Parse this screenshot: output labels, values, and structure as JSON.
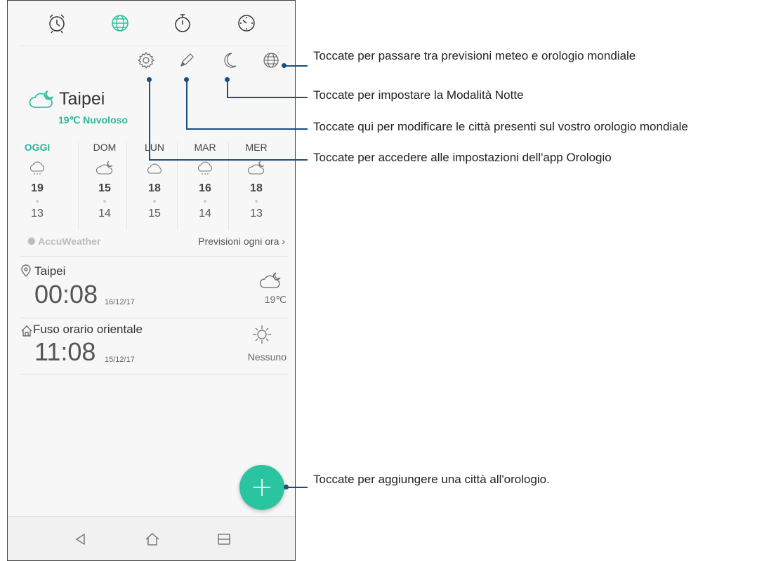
{
  "tabs": [
    {
      "icon": "alarm-clock-icon"
    },
    {
      "icon": "globe-icon",
      "active": true
    },
    {
      "icon": "stopwatch-icon"
    },
    {
      "icon": "timer-icon"
    }
  ],
  "toolbar": [
    "gear-icon",
    "pencil-icon",
    "moon-icon",
    "globe-icon"
  ],
  "weather": {
    "city": "Taipei",
    "current": "19℃  Nuvoloso",
    "days": [
      {
        "name": "OGGI",
        "hi": "19",
        "lo": "13",
        "icon": "rain-cloud-icon",
        "today": true
      },
      {
        "name": "DOM",
        "hi": "15",
        "lo": "14",
        "icon": "partly-cloudy-night-icon"
      },
      {
        "name": "LUN",
        "hi": "18",
        "lo": "15",
        "icon": "cloud-icon"
      },
      {
        "name": "MAR",
        "hi": "16",
        "lo": "14",
        "icon": "rain-cloud-icon"
      },
      {
        "name": "MER",
        "hi": "18",
        "lo": "13",
        "icon": "partly-cloudy-night-icon"
      }
    ],
    "provider": "AccuWeather",
    "hourly_link": "Previsioni ogni ora ›"
  },
  "cities": [
    {
      "name": "Taipei",
      "time": "00:08",
      "date": "16/12/17",
      "weather": "19℃",
      "icon": "location-pin-icon"
    },
    {
      "name": "Fuso orario orientale",
      "time": "11:08",
      "date": "15/12/17",
      "weather": "Nessuno",
      "icon": "home-icon"
    }
  ],
  "callouts": [
    "Toccate per passare tra previsioni meteo e orologio mondiale",
    "Toccate per impostare la Modalità Notte",
    "Toccate qui per modificare le città presenti sul vostro orologio mondiale",
    "Toccate per accedere alle impostazioni dell'app Orologio",
    "Toccate per aggiungere una città all'orologio."
  ],
  "colors": {
    "accent": "#2bc4a0",
    "callout": "#1b4e80"
  }
}
